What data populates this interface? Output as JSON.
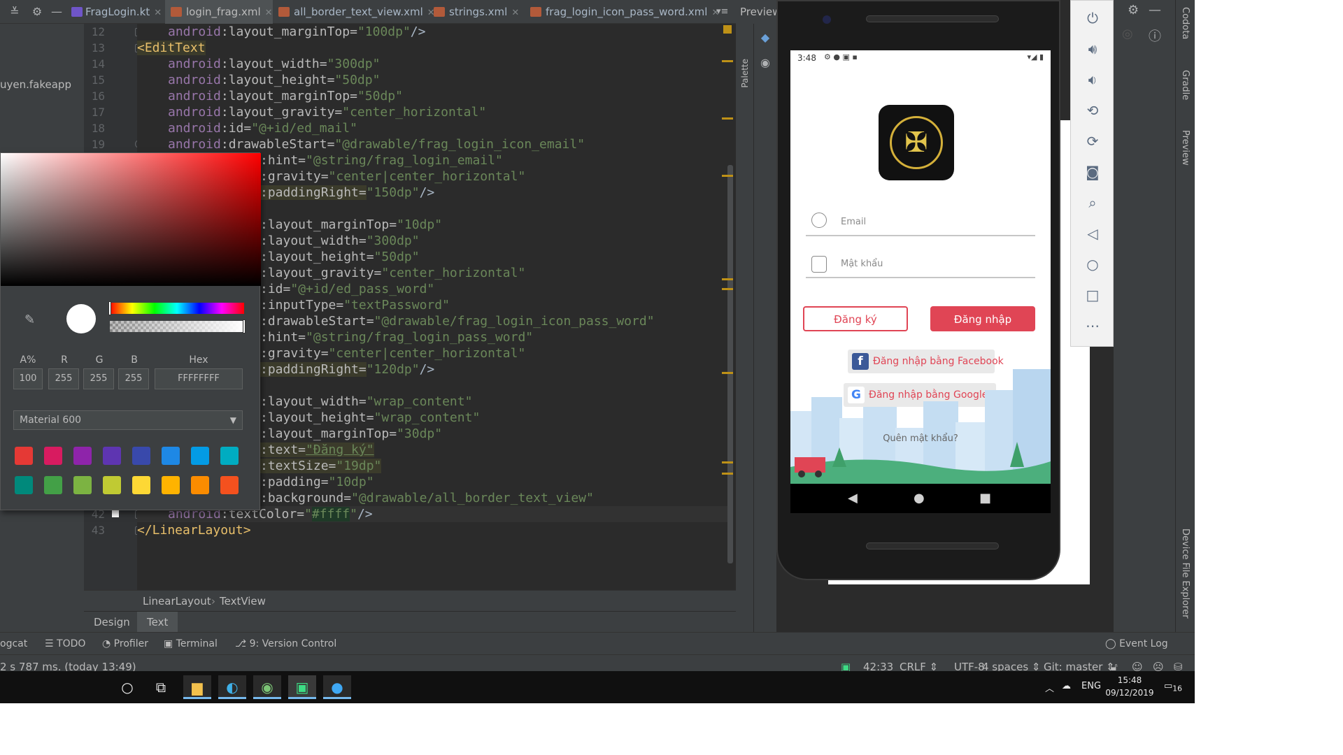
{
  "tabs": [
    {
      "label": "FragLogin.kt"
    },
    {
      "label": "login_frag.xml"
    },
    {
      "label": "all_border_text_view.xml"
    },
    {
      "label": "strings.xml"
    },
    {
      "label": "frag_login_icon_pass_word.xml"
    }
  ],
  "tab_overflow": "▾≡",
  "project_item": "uyen.fakeapp",
  "preview_label": "Preview",
  "palette_label": "Palette",
  "line_numbers": [
    "12",
    "13",
    "14",
    "15",
    "16",
    "17",
    "18",
    "19",
    "42",
    "43"
  ],
  "code": {
    "l12": [
      "android",
      ":layout_marginTop=",
      "\"100dp\"",
      "/>"
    ],
    "l13": "<EditText",
    "l14": [
      "android",
      ":layout_width=",
      "\"300dp\""
    ],
    "l15": [
      "android",
      ":layout_height=",
      "\"50dp\""
    ],
    "l16": [
      "android",
      ":layout_marginTop=",
      "\"50dp\""
    ],
    "l17": [
      "android",
      ":layout_gravity=",
      "\"center_horizontal\""
    ],
    "l18": [
      "android",
      ":id=",
      "\"@+id/ed_mail\""
    ],
    "l19": [
      "android",
      ":drawableStart=",
      "\"@drawable/frag_login_icon_email\""
    ],
    "l20": [
      ":hint=",
      "\"@string/frag_login_email\""
    ],
    "l21": [
      ":gravity=",
      "\"center|center_horizontal\""
    ],
    "l22": [
      ":paddingRight=",
      "\"150dp\"",
      "/>"
    ],
    "l24": [
      ":layout_marginTop=",
      "\"10dp\""
    ],
    "l25": [
      ":layout_width=",
      "\"300dp\""
    ],
    "l26": [
      ":layout_height=",
      "\"50dp\""
    ],
    "l27": [
      ":layout_gravity=",
      "\"center_horizontal\""
    ],
    "l28": [
      ":id=",
      "\"@+id/ed_pass_word\""
    ],
    "l29": [
      ":inputType=",
      "\"textPassword\""
    ],
    "l30": [
      ":drawableStart=",
      "\"@drawable/frag_login_icon_pass_word\""
    ],
    "l31": [
      ":hint=",
      "\"@string/frag_login_pass_word\""
    ],
    "l32": [
      ":gravity=",
      "\"center|center_horizontal\""
    ],
    "l33": [
      ":paddingRight=",
      "\"120dp\"",
      "/>"
    ],
    "l35": [
      ":layout_width=",
      "\"wrap_content\""
    ],
    "l36": [
      ":layout_height=",
      "\"wrap_content\""
    ],
    "l37": [
      ":layout_marginTop=",
      "\"30dp\""
    ],
    "l38": [
      ":text=",
      "\"Đăng ký\""
    ],
    "l39": [
      ":textSize=",
      "\"19dp\""
    ],
    "l40": [
      ":padding=",
      "\"10dp\""
    ],
    "l41": [
      ":background=",
      "\"@drawable/all_border_text_view\""
    ],
    "l42": [
      "android",
      ":textColor=",
      "\"",
      "#ffff",
      "\"",
      "/>"
    ],
    "l43": "</LinearLayout>"
  },
  "breadcrumb": [
    "LinearLayout",
    "›",
    "TextView"
  ],
  "design_tabs": [
    "Design",
    "Text"
  ],
  "color_picker": {
    "labels": [
      "A%",
      "R",
      "G",
      "B",
      "Hex"
    ],
    "values": [
      "100",
      "255",
      "255",
      "255",
      "FFFFFFFF"
    ],
    "palette": "Material 600",
    "swatches": [
      "#e53935",
      "#d81b60",
      "#8e24aa",
      "#5e35b1",
      "#3949ab",
      "#1e88e5",
      "#039be5",
      "#00acc1",
      "#00897b",
      "#43a047",
      "#7cb342",
      "#c0ca33",
      "#fdd835",
      "#ffb300",
      "#fb8c00",
      "#f4511e"
    ]
  },
  "phone": {
    "time": "3:48",
    "email_placeholder": "Email",
    "password_placeholder": "Mật khẩu",
    "register": "Đăng ký",
    "login": "Đăng nhập",
    "facebook": "Đăng nhập bằng Facebook",
    "google": "Đăng nhập bằng Google",
    "forgot": "Quên mật khẩu?"
  },
  "right_labels": [
    "Codota",
    "Gradle",
    "Preview",
    "Device File Explorer"
  ],
  "bottom_tools": [
    "ogcat",
    "TODO",
    "Profiler",
    "Terminal",
    "9: Version Control",
    "Event Log"
  ],
  "status": {
    "left": "2 s 787 ms. (today 13:49)",
    "position": "42:33",
    "line_sep": "CRLF ⇕",
    "encoding": "UTF-8",
    "indent": "4 spaces ⇕",
    "git": "Git: master ⇕"
  },
  "taskbar": {
    "lang": "ENG",
    "time": "15:48",
    "date": "09/12/2019",
    "notif": "16"
  },
  "colors": {
    "accent": "#e04555",
    "ide_bg": "#2b2b2b",
    "panel": "#3c3f41"
  }
}
